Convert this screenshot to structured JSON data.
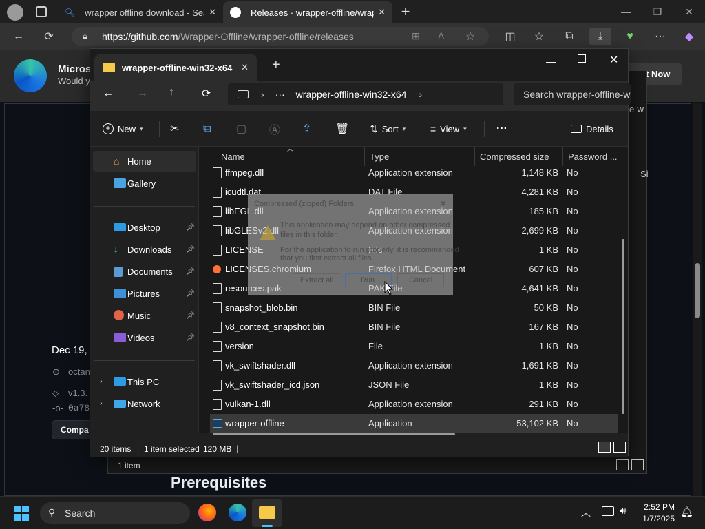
{
  "browser": {
    "tabs": [
      {
        "label": "wrapper offline download - Searc",
        "icon": "search-icon"
      },
      {
        "label": "Releases · wrapper-offline/wrapp",
        "icon": "github-icon"
      }
    ],
    "url_host": "https://github.com",
    "url_path": "/Wrapper-Offline/wrapper-offline/releases"
  },
  "webpage": {
    "edge_banner_title": "Microso",
    "edge_banner_sub": "Would y",
    "edge_banner_button": "t Now",
    "release_date": "Dec 19,",
    "release_author": "octan",
    "release_tag": "v1.3.",
    "release_commit": "0a78",
    "compare_button": "Compa",
    "prereq_heading": "Prerequisites",
    "side_text_1": "e-w",
    "side_text_2": "Si"
  },
  "explorer_back": {
    "status": "1 item"
  },
  "explorer": {
    "tab_title": "wrapper-offline-win32-x64",
    "breadcrumb": "wrapper-offline-win32-x64",
    "breadcrumb_more": "···",
    "search_placeholder": "Search wrapper-offline-w",
    "toolbar": {
      "new_label": "New",
      "sort_label": "Sort",
      "view_label": "View",
      "more_label": "···",
      "details_label": "Details"
    },
    "nav": {
      "home": "Home",
      "gallery": "Gallery",
      "desktop": "Desktop",
      "downloads": "Downloads",
      "documents": "Documents",
      "pictures": "Pictures",
      "music": "Music",
      "videos": "Videos",
      "thispc": "This PC",
      "network": "Network"
    },
    "columns": {
      "name": "Name",
      "type": "Type",
      "size": "Compressed size",
      "password": "Password ..."
    },
    "files": [
      {
        "name": "ffmpeg.dll",
        "type": "Application extension",
        "size": "1,148 KB",
        "password": "No"
      },
      {
        "name": "icudtl.dat",
        "type": "DAT File",
        "size": "4,281 KB",
        "password": "No"
      },
      {
        "name": "libEGL.dll",
        "type": "Application extension",
        "size": "185 KB",
        "password": "No"
      },
      {
        "name": "libGLESv2.dll",
        "type": "Application extension",
        "size": "2,699 KB",
        "password": "No"
      },
      {
        "name": "LICENSE",
        "type": "File",
        "size": "1 KB",
        "password": "No"
      },
      {
        "name": "LICENSES.chromium",
        "type": "Firefox HTML Document",
        "size": "607 KB",
        "password": "No"
      },
      {
        "name": "resources.pak",
        "type": "PAK File",
        "size": "4,641 KB",
        "password": "No"
      },
      {
        "name": "snapshot_blob.bin",
        "type": "BIN File",
        "size": "50 KB",
        "password": "No"
      },
      {
        "name": "v8_context_snapshot.bin",
        "type": "BIN File",
        "size": "167 KB",
        "password": "No"
      },
      {
        "name": "version",
        "type": "File",
        "size": "1 KB",
        "password": "No"
      },
      {
        "name": "vk_swiftshader.dll",
        "type": "Application extension",
        "size": "1,691 KB",
        "password": "No"
      },
      {
        "name": "vk_swiftshader_icd.json",
        "type": "JSON File",
        "size": "1 KB",
        "password": "No"
      },
      {
        "name": "vulkan-1.dll",
        "type": "Application extension",
        "size": "291 KB",
        "password": "No"
      },
      {
        "name": "wrapper-offline",
        "type": "Application",
        "size": "53,102 KB",
        "password": "No"
      }
    ],
    "status": {
      "items": "20 items",
      "selected": "1 item selected",
      "size": "120 MB"
    }
  },
  "dialog": {
    "title": "Compressed (zipped) Folders",
    "line1": "This application may depend on other compressed",
    "line2": "files in this folder.",
    "line3": "For the application to run properly, it is recommended",
    "line4": "that you first extract all files.",
    "extract_label": "Extract all",
    "run_label": "Run",
    "cancel_label": "Cancel"
  },
  "taskbar": {
    "search_label": "Search",
    "time": "2:52 PM",
    "date": "1/7/2025"
  },
  "colors": {
    "accent": "#60cdff",
    "folder": "#f7c948"
  }
}
